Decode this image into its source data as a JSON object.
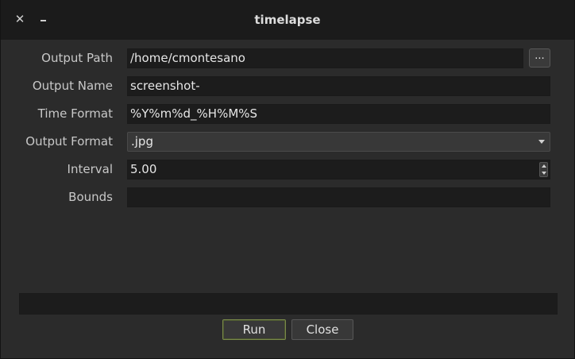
{
  "window": {
    "title": "timelapse",
    "close_glyph": "✕"
  },
  "form": {
    "output_path": {
      "label": "Output Path",
      "value": "/home/cmontesano",
      "browse_label": "..."
    },
    "output_name": {
      "label": "Output Name",
      "value": "screenshot-"
    },
    "time_format": {
      "label": "Time Format",
      "value": "%Y%m%d_%H%M%S"
    },
    "output_format": {
      "label": "Output Format",
      "value": ".jpg"
    },
    "interval": {
      "label": "Interval",
      "value": "5.00"
    },
    "bounds": {
      "label": "Bounds",
      "value": ""
    }
  },
  "status": {
    "text": ""
  },
  "buttons": {
    "run_label": "Run",
    "close_label": "Close"
  },
  "icons": {
    "close": "close-icon",
    "minimize": "minimize-icon",
    "dropdown": "chevron-down-icon",
    "spin_up": "chevron-up-icon",
    "spin_down": "chevron-down-icon"
  },
  "colors": {
    "background": "#2b2b2b",
    "titlebar": "#1b1b1b",
    "field": "#1c1c1c",
    "accent_run_border": "#7a8a4a"
  }
}
